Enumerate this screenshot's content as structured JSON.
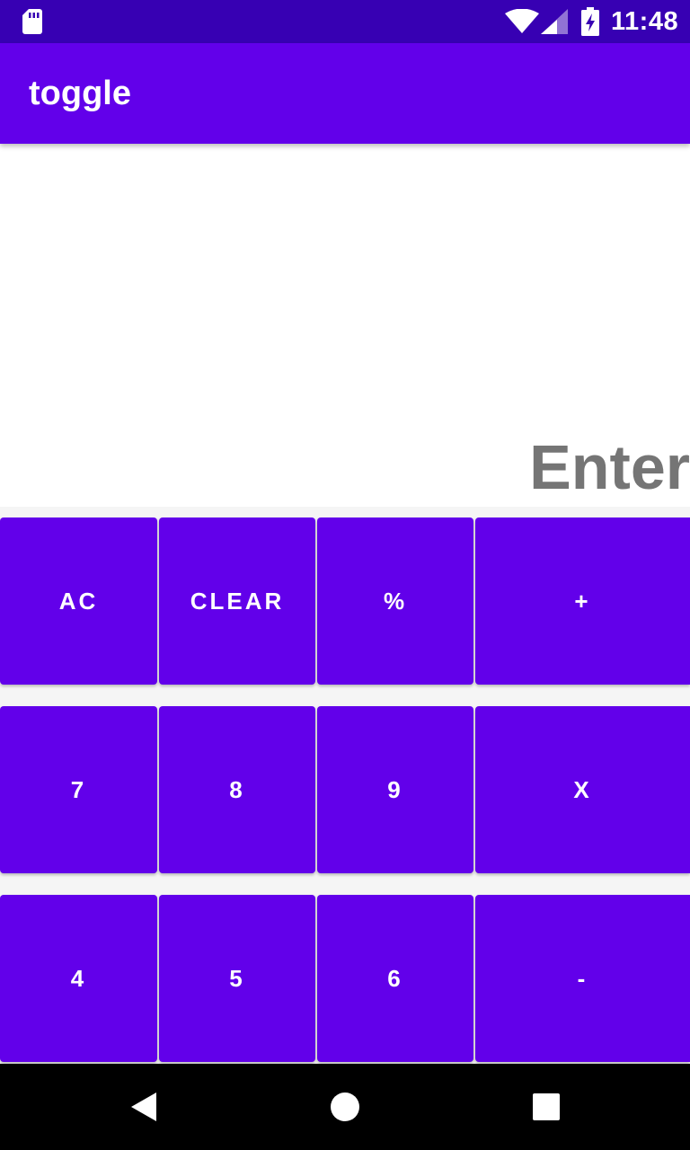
{
  "status_bar": {
    "time": "11:48",
    "icons": [
      "sd-card-icon",
      "wifi-icon",
      "signal-icon",
      "battery-charging-icon"
    ]
  },
  "app_bar": {
    "title": "toggle"
  },
  "display": {
    "text": "Enter"
  },
  "keypad": {
    "rows": [
      [
        "AC",
        "CLEAR",
        "%",
        "+"
      ],
      [
        "7",
        "8",
        "9",
        "X"
      ],
      [
        "4",
        "5",
        "6",
        "-"
      ]
    ]
  },
  "nav_bar": {
    "icons": [
      "back-icon",
      "home-icon",
      "recents-icon"
    ]
  },
  "colors": {
    "status_bar": "#3700b3",
    "primary": "#6200ea",
    "display_text": "#757575",
    "keypad_background": "#f5f5f5"
  }
}
